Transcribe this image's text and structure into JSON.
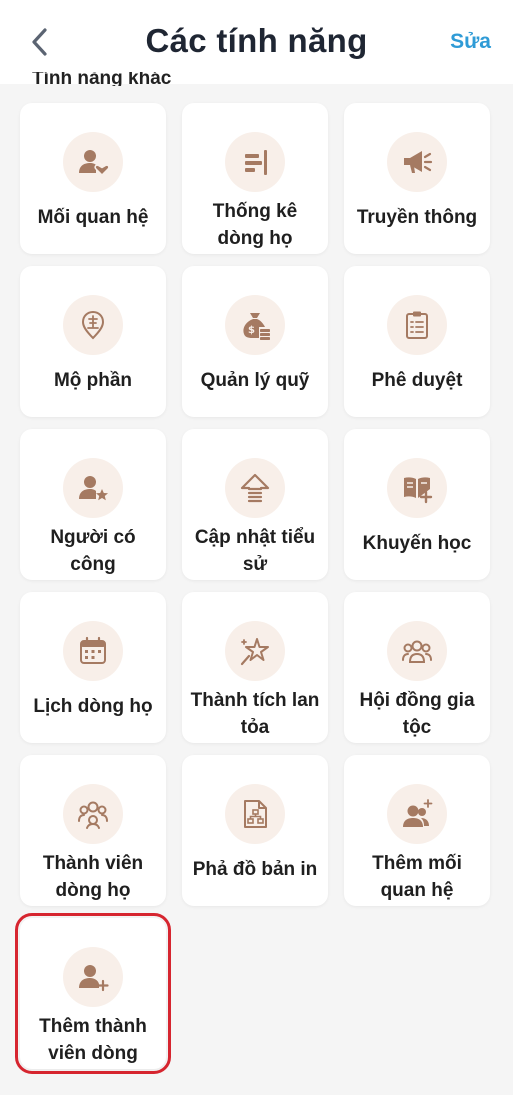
{
  "header": {
    "title": "Các tính năng",
    "edit_label": "Sửa",
    "section_title": "Tính năng khác"
  },
  "colors": {
    "accent": "#2f9bd6",
    "icon": "#a57a62",
    "icon_bg": "#f8efe9",
    "highlight": "#d6252f"
  },
  "features": [
    {
      "label": "Mối quan hệ",
      "icon": "person-heart-icon"
    },
    {
      "label": "Thống kê dòng họ",
      "icon": "bar-stats-icon"
    },
    {
      "label": "Truyền thông",
      "icon": "megaphone-icon"
    },
    {
      "label": "Mộ phần",
      "icon": "grave-pin-icon"
    },
    {
      "label": "Quản lý quỹ",
      "icon": "money-bag-icon"
    },
    {
      "label": "Phê duyệt",
      "icon": "clipboard-list-icon"
    },
    {
      "label": "Người có công",
      "icon": "person-star-icon"
    },
    {
      "label": "Cập nhật tiểu sử",
      "icon": "upload-arrow-icon"
    },
    {
      "label": "Khuyến học",
      "icon": "book-plus-icon"
    },
    {
      "label": "Lịch dòng họ",
      "icon": "calendar-icon"
    },
    {
      "label": "Thành tích lan tỏa",
      "icon": "sparkle-star-icon"
    },
    {
      "label": "Hội đồng gia tộc",
      "icon": "group-council-icon"
    },
    {
      "label": "Thành viên dòng họ",
      "icon": "members-group-icon"
    },
    {
      "label": "Phả đồ bản in",
      "icon": "family-tree-document-icon"
    },
    {
      "label": "Thêm mối quan hệ",
      "icon": "add-relation-icon"
    },
    {
      "label": "Thêm thành viên dòng",
      "icon": "add-member-icon"
    }
  ]
}
